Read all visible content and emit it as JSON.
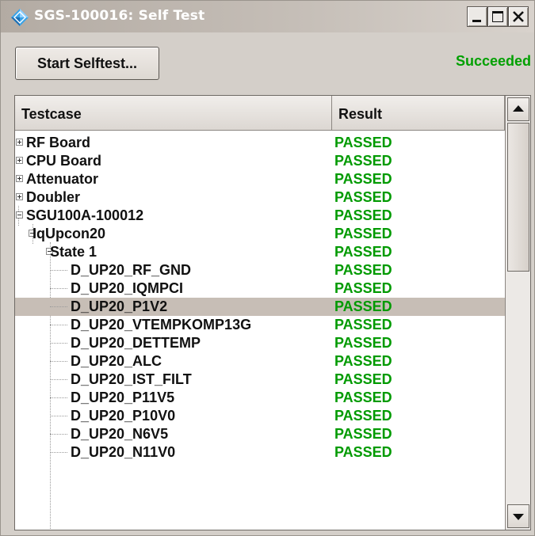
{
  "window": {
    "title": "SGS-100016: Self Test"
  },
  "toolbar": {
    "start_label": "Start Selftest...",
    "status": "Succeeded"
  },
  "table": {
    "columns": [
      "Testcase",
      "Result"
    ],
    "rows": [
      {
        "name": "RF Board",
        "result": "PASSED",
        "level": 0,
        "expander": "plus"
      },
      {
        "name": "CPU Board",
        "result": "PASSED",
        "level": 0,
        "expander": "plus"
      },
      {
        "name": "Attenuator",
        "result": "PASSED",
        "level": 0,
        "expander": "plus"
      },
      {
        "name": "Doubler",
        "result": "PASSED",
        "level": 0,
        "expander": "plus"
      },
      {
        "name": "SGU100A-100012",
        "result": "PASSED",
        "level": 0,
        "expander": "minus"
      },
      {
        "name": "IqUpcon20",
        "result": "PASSED",
        "level": 1,
        "expander": "minus"
      },
      {
        "name": "State 1",
        "result": "PASSED",
        "level": 2,
        "expander": "minus"
      },
      {
        "name": "D_UP20_RF_GND",
        "result": "PASSED",
        "level": 3,
        "expander": "none"
      },
      {
        "name": "D_UP20_IQMPCI",
        "result": "PASSED",
        "level": 3,
        "expander": "none"
      },
      {
        "name": "D_UP20_P1V2",
        "result": "PASSED",
        "level": 3,
        "expander": "none",
        "selected": true
      },
      {
        "name": "D_UP20_VTEMPKOMP13G",
        "result": "PASSED",
        "level": 3,
        "expander": "none"
      },
      {
        "name": "D_UP20_DETTEMP",
        "result": "PASSED",
        "level": 3,
        "expander": "none"
      },
      {
        "name": "D_UP20_ALC",
        "result": "PASSED",
        "level": 3,
        "expander": "none"
      },
      {
        "name": "D_UP20_IST_FILT",
        "result": "PASSED",
        "level": 3,
        "expander": "none"
      },
      {
        "name": "D_UP20_P11V5",
        "result": "PASSED",
        "level": 3,
        "expander": "none"
      },
      {
        "name": "D_UP20_P10V0",
        "result": "PASSED",
        "level": 3,
        "expander": "none"
      },
      {
        "name": "D_UP20_N6V5",
        "result": "PASSED",
        "level": 3,
        "expander": "none"
      },
      {
        "name": "D_UP20_N11V0",
        "result": "PASSED",
        "level": 3,
        "expander": "none"
      }
    ]
  },
  "icons": {
    "app": "diamond-logo-icon",
    "minimize": "minimize-icon",
    "maximize": "maximize-icon",
    "close": "close-icon",
    "scroll_up": "arrow-up-icon",
    "scroll_down": "arrow-down-icon"
  },
  "colors": {
    "status_success": "#00a000",
    "result_passed": "#009a00",
    "selection": "#c7beb6"
  }
}
